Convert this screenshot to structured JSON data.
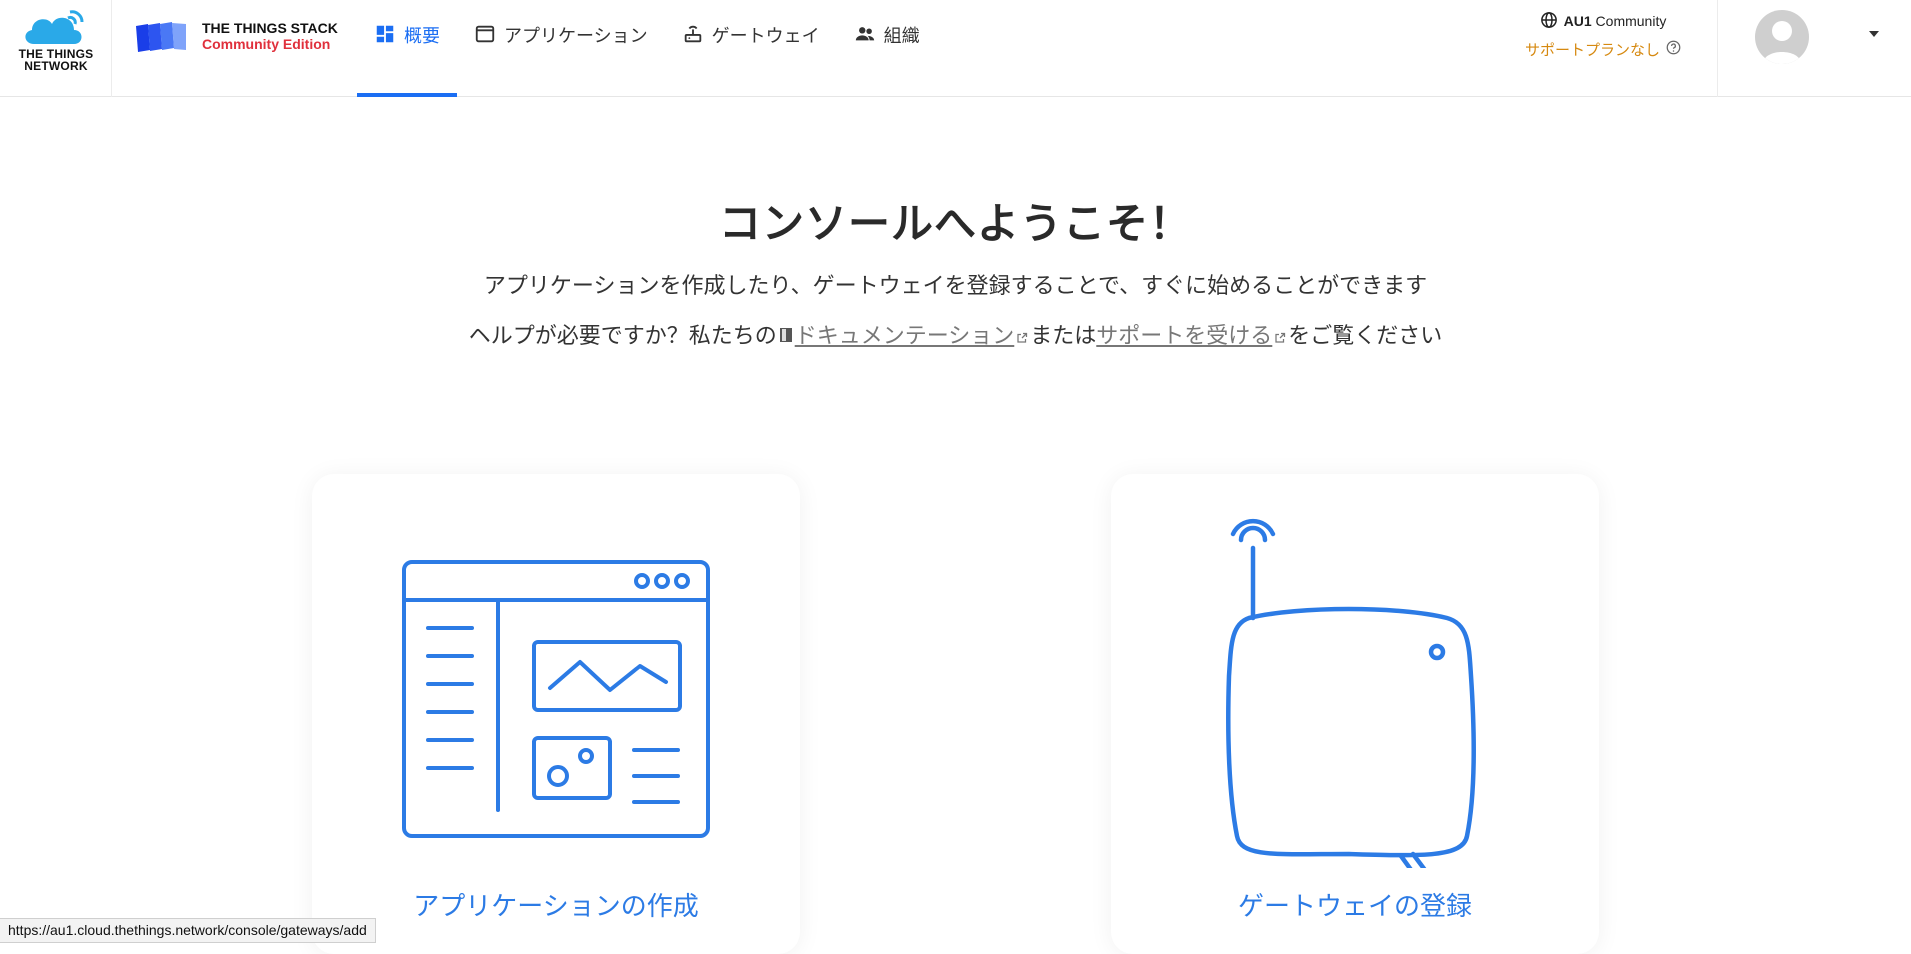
{
  "brand": {
    "ttn_text_line1": "THE THINGS",
    "ttn_text_line2": "NETWORK",
    "stack_title": "THE THINGS STACK",
    "stack_edition": "Community Edition"
  },
  "nav": {
    "items": [
      {
        "label": "概要",
        "icon": "dashboard-icon",
        "active": true
      },
      {
        "label": "アプリケーション",
        "icon": "window-icon",
        "active": false
      },
      {
        "label": "ゲートウェイ",
        "icon": "router-icon",
        "active": false
      },
      {
        "label": "組織",
        "icon": "people-icon",
        "active": false
      }
    ]
  },
  "cluster": {
    "region": "AU1",
    "name": "Community",
    "support": "サポートプランなし"
  },
  "main": {
    "title": "コンソールへようこそ！",
    "subtitle": "アプリケーションを作成したり、ゲートウェイを登録することで、すぐに始めることができます",
    "help_prefix": "ヘルプが必要ですか？私たちの",
    "docs_link": "ドキュメンテーション",
    "help_middle": "または",
    "support_link": "サポートを受ける",
    "help_suffix": "をご覧ください"
  },
  "cards": {
    "app_label": "アプリケーションの作成",
    "gateway_label": "ゲートウェイの登録"
  },
  "status_url": "https://au1.cloud.thethings.network/console/gateways/add",
  "colors": {
    "accent": "#1b6ef3",
    "card_text": "#2c7be5",
    "warning": "#d68910",
    "edition_red": "#e0303c"
  }
}
